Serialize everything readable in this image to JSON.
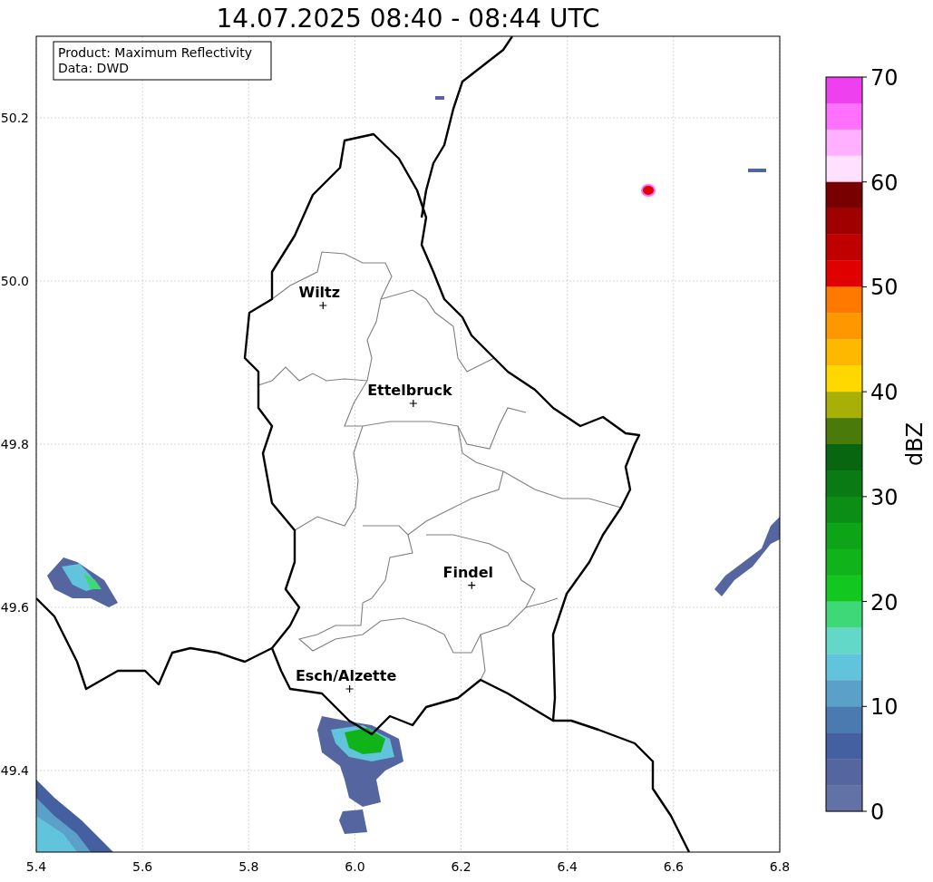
{
  "map": {
    "info_box": {
      "lines": [
        "Product: Maximum Reflectivity",
        "Data: DWD"
      ]
    },
    "chart_data": {
      "type": "scatter",
      "title": "14.07.2025 08:40 - 08:44 UTC",
      "xlim": [
        5.4,
        6.8
      ],
      "ylim": [
        49.3,
        50.3
      ],
      "xticks": [
        {
          "value": 5.4,
          "label": "5.4"
        },
        {
          "value": 5.6,
          "label": "5.6"
        },
        {
          "value": 5.8,
          "label": "5.8"
        },
        {
          "value": 6.0,
          "label": "6.0"
        },
        {
          "value": 6.2,
          "label": "6.2"
        },
        {
          "value": 6.4,
          "label": "6.4"
        },
        {
          "value": 6.6,
          "label": "6.6"
        },
        {
          "value": 6.8,
          "label": "6.8"
        }
      ],
      "yticks": [
        {
          "value": 49.4,
          "label": "49.4"
        },
        {
          "value": 49.6,
          "label": "49.6"
        },
        {
          "value": 49.8,
          "label": "49.8"
        },
        {
          "value": 50.0,
          "label": "50.0"
        },
        {
          "value": 50.2,
          "label": "50.2"
        }
      ],
      "grid": true,
      "x": [
        5.94,
        6.11,
        6.22,
        5.99
      ],
      "series": [
        {
          "color": "#000000",
          "values": [
            49.97,
            49.85,
            49.627,
            49.5
          ]
        }
      ],
      "annotations": [
        "Wiltz",
        "Ettelbruck",
        "Findel",
        "Esch/Alzette"
      ]
    }
  },
  "colorbar": {
    "label": "dBZ",
    "ticks": [
      "70",
      "60",
      "50",
      "40",
      "30",
      "20",
      "10",
      "0"
    ],
    "bands": [
      {
        "color": "#ee40ee"
      },
      {
        "color": "#ff70ff"
      },
      {
        "color": "#ffb0ff"
      },
      {
        "color": "#ffe0ff"
      },
      {
        "color": "#780000"
      },
      {
        "color": "#a00000"
      },
      {
        "color": "#c00000"
      },
      {
        "color": "#e00000"
      },
      {
        "color": "#ff7800"
      },
      {
        "color": "#ff9800"
      },
      {
        "color": "#ffb800"
      },
      {
        "color": "#ffd800"
      },
      {
        "color": "#a8b008"
      },
      {
        "color": "#4a7a0a"
      },
      {
        "color": "#086610"
      },
      {
        "color": "#0a7a14"
      },
      {
        "color": "#0c8e16"
      },
      {
        "color": "#0ea418"
      },
      {
        "color": "#10b41a"
      },
      {
        "color": "#12c820"
      },
      {
        "color": "#3ed878"
      },
      {
        "color": "#62d8c8"
      },
      {
        "color": "#62c4dc"
      },
      {
        "color": "#5aa0c8"
      },
      {
        "color": "#4a7ab0"
      },
      {
        "color": "#4560a0"
      },
      {
        "color": "#5565a0"
      },
      {
        "color": "#6372a6"
      }
    ]
  }
}
